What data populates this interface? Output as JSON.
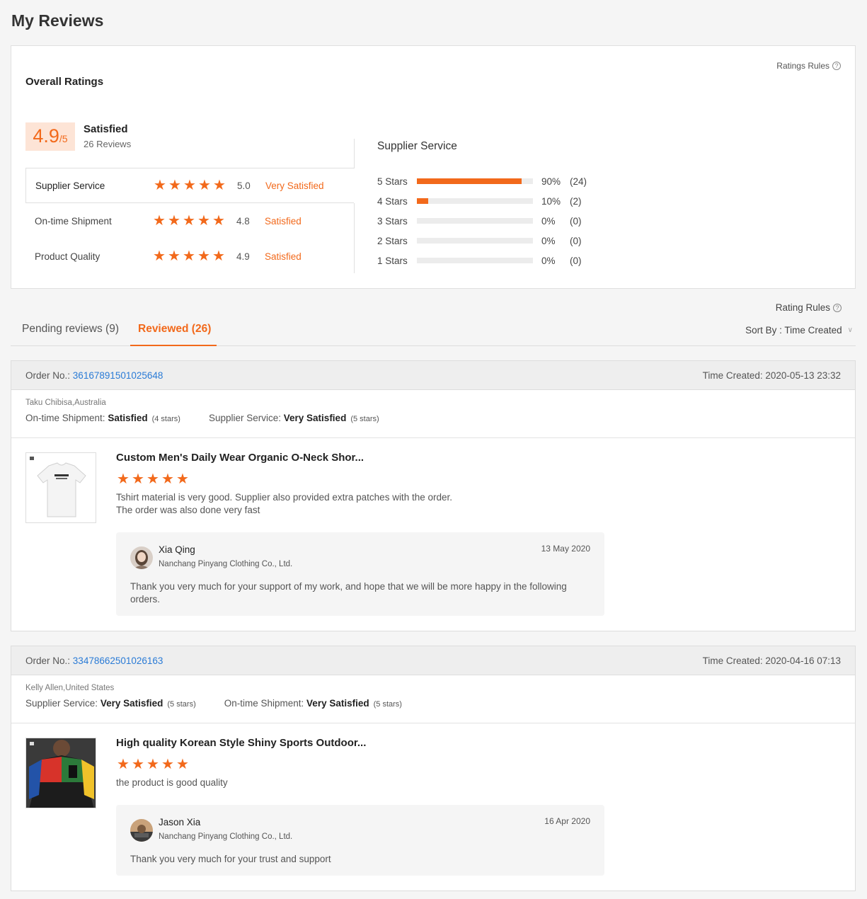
{
  "page": {
    "title": "My Reviews"
  },
  "overall": {
    "title": "Overall Ratings",
    "rules_label": "Ratings Rules",
    "score": "4.9",
    "score_suffix": "/5",
    "status": "Satisfied",
    "count": "26 Reviews",
    "dimensions": [
      {
        "name": "Supplier Service",
        "score": "5.0",
        "rating": 5.0,
        "status": "Very Satisfied"
      },
      {
        "name": "On-time Shipment",
        "score": "4.8",
        "rating": 4.8,
        "status": "Satisfied"
      },
      {
        "name": "Product Quality",
        "score": "4.9",
        "rating": 4.9,
        "status": "Satisfied"
      }
    ]
  },
  "distribution": {
    "title": "Supplier Service",
    "rows": [
      {
        "label": "5  Stars",
        "percent": 90,
        "pct_text": "90%",
        "count": "(24)"
      },
      {
        "label": "4  Stars",
        "percent": 10,
        "pct_text": "10%",
        "count": "(2)"
      },
      {
        "label": "3  Stars",
        "percent": 0,
        "pct_text": "0%",
        "count": "(0)"
      },
      {
        "label": "2  Stars",
        "percent": 0,
        "pct_text": "0%",
        "count": "(0)"
      },
      {
        "label": "1  Stars",
        "percent": 0,
        "pct_text": "0%",
        "count": "(0)"
      }
    ]
  },
  "tabs": {
    "pending": "Pending reviews (9)",
    "reviewed": "Reviewed (26)",
    "rating_rules": "Rating Rules",
    "sort_by": "Sort By : Time Created"
  },
  "colors": {
    "accent": "#f2691b",
    "link": "#2a7bd6"
  },
  "orders": [
    {
      "order_label": "Order No.:",
      "order_no": "36167891501025648",
      "time_created": "Time Created: 2020-05-13 23:32",
      "buyer": "Taku Chibisa,Australia",
      "ratings": [
        {
          "label": "On-time Shipment:",
          "value": "Satisfied",
          "stars": "(4 stars)"
        },
        {
          "label": "Supplier Service:",
          "value": "Very Satisfied",
          "stars": "(5 stars)"
        }
      ],
      "product_title": "Custom Men's Daily Wear Organic O-Neck Shor...",
      "product_image": "white-tshirt",
      "review_rating": 5,
      "review_text": [
        "Tshirt material is very good. Supplier also provided extra patches with the order.",
        "The order was also done very fast"
      ],
      "reply": {
        "name": "Xia Qing",
        "company": "Nanchang Pinyang Clothing Co., Ltd.",
        "date": "13 May 2020",
        "text": "Thank you very much for your support of my work, and hope that we will be more happy in the following orders."
      }
    },
    {
      "order_label": "Order No.:",
      "order_no": "33478662501026163",
      "time_created": "Time Created: 2020-04-16 07:13",
      "buyer": "Kelly Allen,United States",
      "ratings": [
        {
          "label": "Supplier Service:",
          "value": "Very Satisfied",
          "stars": "(5 stars)"
        },
        {
          "label": "On-time Shipment:",
          "value": "Very Satisfied",
          "stars": "(5 stars)"
        }
      ],
      "product_title": "High quality Korean Style Shiny Sports Outdoor...",
      "product_image": "colorblock-jacket",
      "review_rating": 5,
      "review_text": [
        "the product is good quality"
      ],
      "reply": {
        "name": "Jason Xia",
        "company": "Nanchang Pinyang Clothing Co., Ltd.",
        "date": "16 Apr 2020",
        "text": "Thank you very much for your trust and support"
      }
    }
  ]
}
